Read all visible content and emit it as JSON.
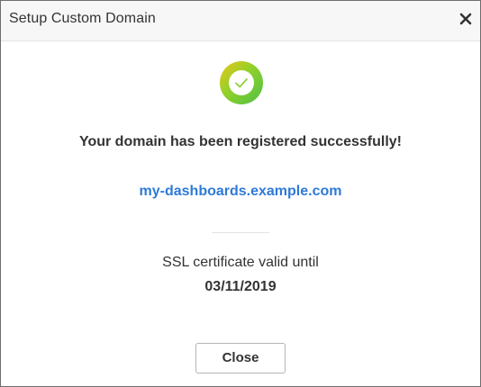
{
  "dialog": {
    "title": "Setup Custom Domain",
    "close_icon": "close-icon"
  },
  "status": {
    "icon": "check-circle-icon",
    "gradient_colors": [
      "#f0c419",
      "#7ed321",
      "#5cc443"
    ],
    "message": "Your domain has been registered successfully!"
  },
  "domain": {
    "url": "my-dashboards.example.com",
    "color": "#2e7ad6"
  },
  "ssl": {
    "label": "SSL certificate valid until",
    "valid_until": "03/11/2019"
  },
  "footer": {
    "close_label": "Close"
  }
}
